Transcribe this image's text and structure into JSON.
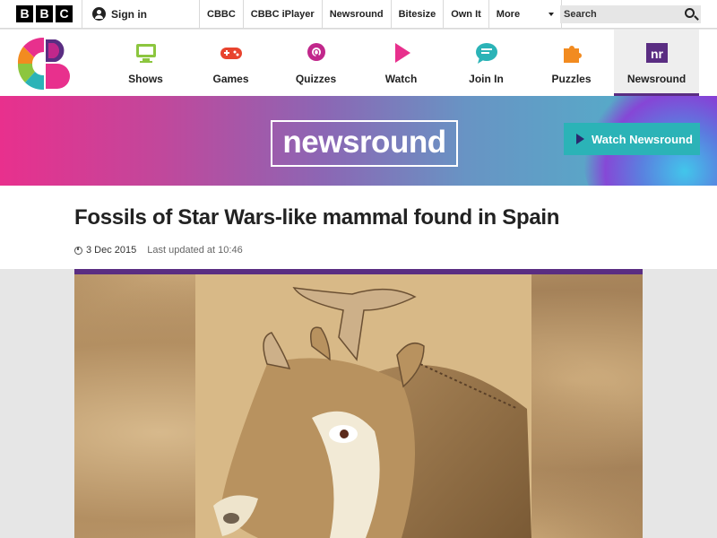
{
  "bbc_bar": {
    "logo_letters": [
      "B",
      "B",
      "C"
    ],
    "sign_in": "Sign in",
    "links": [
      "CBBC",
      "CBBC iPlayer",
      "Newsround",
      "Bitesize",
      "Own It"
    ],
    "more": "More",
    "search_placeholder": "Search"
  },
  "cbbc_nav": {
    "items": [
      {
        "label": "Shows",
        "icon": "tv-icon",
        "color": "#8cc63f"
      },
      {
        "label": "Games",
        "icon": "gamepad-icon",
        "color": "#e8432e"
      },
      {
        "label": "Quizzes",
        "icon": "quiz-icon",
        "color": "#c1278b"
      },
      {
        "label": "Watch",
        "icon": "play-icon",
        "color": "#e8308d"
      },
      {
        "label": "Join In",
        "icon": "chat-icon",
        "color": "#2bb3b7"
      },
      {
        "label": "Puzzles",
        "icon": "puzzle-icon",
        "color": "#f28b20"
      },
      {
        "label": "Newsround",
        "icon": "newsround-icon",
        "color": "#5a2d82",
        "active": true
      }
    ]
  },
  "banner": {
    "logo_text": "newsround",
    "watch_button": "Watch Newsround"
  },
  "article": {
    "headline": "Fossils of Star Wars-like mammal found in Spain",
    "date": "3 Dec 2015",
    "last_updated": "Last updated at 10:46"
  },
  "colors": {
    "brand_purple": "#5a2d82",
    "watch_button": "#2bb3b7"
  }
}
